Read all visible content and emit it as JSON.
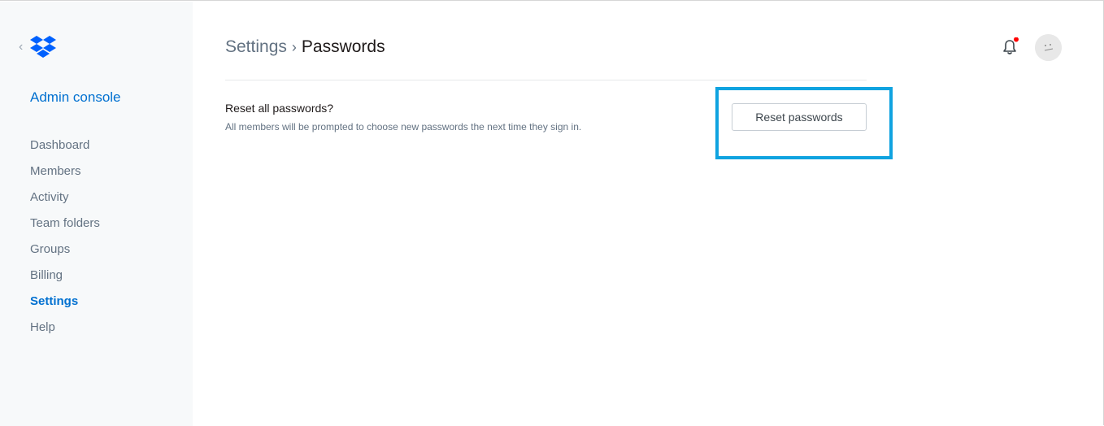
{
  "sidebar": {
    "back_icon": "chevron-left-icon",
    "logo_icon": "dropbox-logo-icon",
    "title": "Admin console",
    "items": [
      {
        "label": "Dashboard",
        "active": false
      },
      {
        "label": "Members",
        "active": false
      },
      {
        "label": "Activity",
        "active": false
      },
      {
        "label": "Team folders",
        "active": false
      },
      {
        "label": "Groups",
        "active": false
      },
      {
        "label": "Billing",
        "active": false
      },
      {
        "label": "Settings",
        "active": true
      },
      {
        "label": "Help",
        "active": false
      }
    ]
  },
  "header": {
    "breadcrumb": {
      "parent": "Settings",
      "separator": "›",
      "current": "Passwords"
    },
    "notification_icon": "bell-icon",
    "notification_badge_color": "#ff0000",
    "avatar_icon": "avatar-icon"
  },
  "setting": {
    "title": "Reset all passwords?",
    "description": "All members will be prompted to choose new passwords the next time they sign in.",
    "button_label": "Reset passwords"
  },
  "colors": {
    "accent": "#0070d0",
    "highlight": "#0fa3e0",
    "sidebar_bg": "#f7f9fa",
    "muted_text": "#637282"
  }
}
